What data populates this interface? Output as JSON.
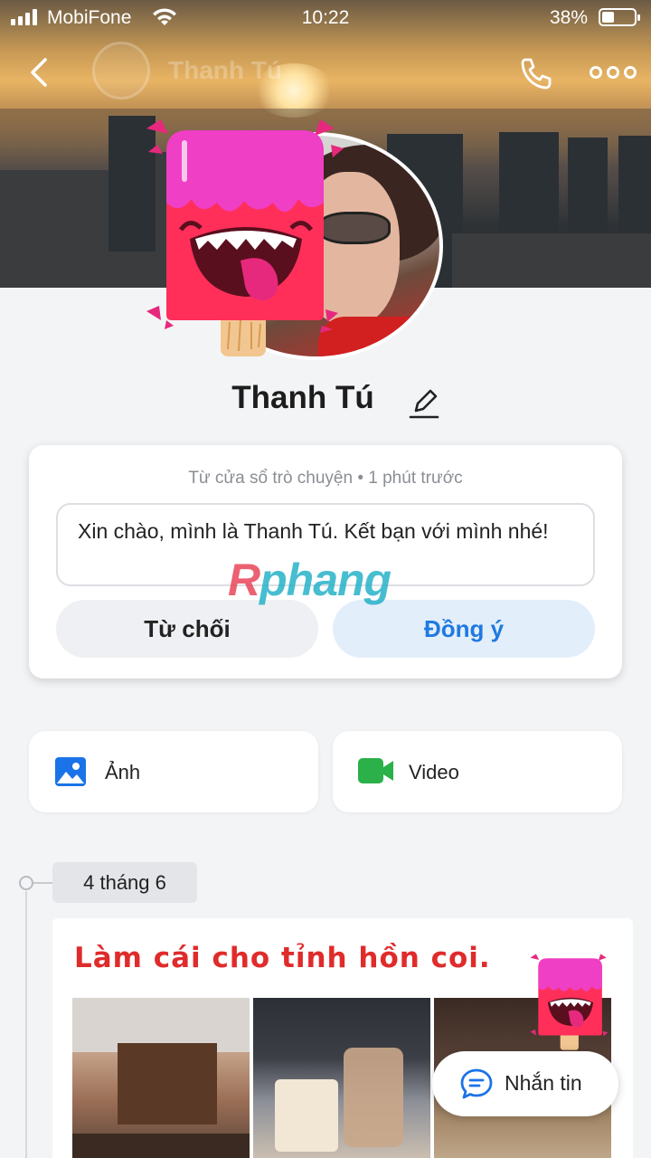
{
  "status_bar": {
    "carrier": "MobiFone",
    "time": "10:22",
    "battery": "38%",
    "battery_level": 0.38
  },
  "nav": {
    "title": "Thanh Tú",
    "back_icon": "chevron-left-icon",
    "call_icon": "phone-icon",
    "more_icon": "more-dots-icon"
  },
  "profile": {
    "name": "Thanh Tú",
    "edit_icon": "pencil-icon"
  },
  "friend_request": {
    "meta": "Từ cửa sổ trò chuyện • 1 phút trước",
    "message": "Xin chào, mình là Thanh Tú. Kết bạn với mình nhé!",
    "decline_label": "Từ chối",
    "accept_label": "Đồng ý"
  },
  "watermark": {
    "first": "R",
    "rest": "phang"
  },
  "media_tiles": [
    {
      "label": "Ảnh",
      "icon": "image-icon",
      "color": "#1a73e8"
    },
    {
      "label": "Video",
      "icon": "video-camera-icon",
      "color": "#2bb04a"
    }
  ],
  "timeline": {
    "date": "4 tháng 6",
    "post_text": "Làm cái cho tỉnh hồn coi."
  },
  "message_button": {
    "label": "Nhắn tin",
    "icon": "chat-bubble-icon"
  },
  "colors": {
    "accent": "#1f7ae0",
    "post_text": "#e02b2b"
  }
}
